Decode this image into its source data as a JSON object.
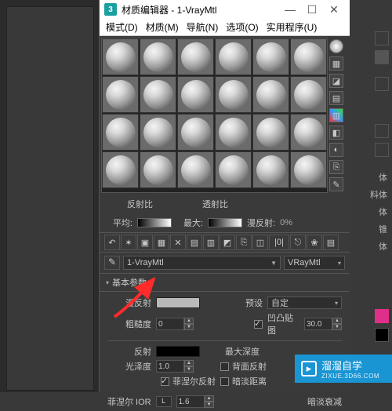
{
  "titlebar": {
    "app_icon_text": "3",
    "title": "材质编辑器 - 1-VrayMtl",
    "min": "—",
    "max": "☐",
    "close": "✕"
  },
  "menu": {
    "mode": "模式(D)",
    "material": "材质(M)",
    "navigate": "导航(N)",
    "options": "选项(O)",
    "utilities": "实用程序(U)"
  },
  "side_icons": [
    "◯",
    "▦",
    "◪",
    "▤",
    "▥",
    "◧",
    "◐",
    "⎘",
    "✎"
  ],
  "reflect_row": {
    "l1": "反射比",
    "avg": "平均:",
    "max": "最大:",
    "l2": "透射比",
    "avg2": "平均:",
    "max2": "最大:",
    "l3": "漫反射:",
    "pct": "0%"
  },
  "tool_icons": [
    "↶",
    "✶",
    "▣",
    "▦",
    "✕",
    "▤",
    "▥",
    "◩",
    "⎘",
    "◫",
    "|0|",
    "⎋",
    "❀",
    "▤"
  ],
  "mat_row": {
    "eyedrop": "✎",
    "name": "1-VrayMtl",
    "type": "VRayMtl"
  },
  "section": {
    "basic": "基本参数"
  },
  "params": {
    "diffuse_label": "漫反射",
    "preset_label": "预设",
    "preset_value": "自定",
    "rough_label": "粗糙度",
    "rough_value": "0",
    "bump_label": "凹凸贴图",
    "bump_value": "30.0",
    "reflect_label": "反射",
    "maxdepth_label": "最大深度",
    "gloss_label": "光泽度",
    "gloss_value": "1.0",
    "backface_label": "背面反射",
    "fresnel_label": "菲涅尔反射",
    "dimdist_label": "暗淡距离",
    "ior_label": "菲涅尔 IOR",
    "ior_lock": "L",
    "ior_value": "1.6",
    "dimfall_label": "暗淡衰减"
  },
  "right": {
    "items": [
      "体",
      "料体",
      "体",
      "锥",
      "体"
    ]
  },
  "watermark": {
    "brand": "溜溜自学",
    "url": "ZIXUE.3D66.COM"
  }
}
